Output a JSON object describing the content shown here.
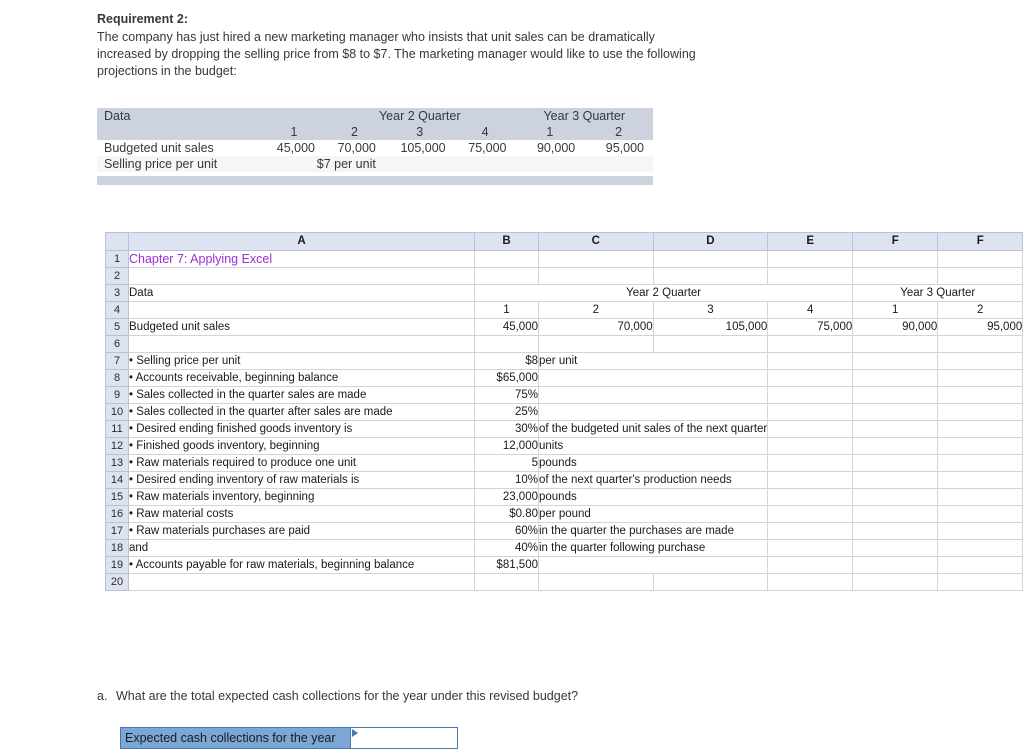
{
  "requirement": {
    "title": "Requirement 2:",
    "paragraph": "The company has just hired a new marketing manager who insists that unit sales can be dramatically increased by dropping the selling price from $8 to $7. The marketing manager would like to use the following projections in the budget:"
  },
  "data_table": {
    "header_label": "Data",
    "group_year2": "Year 2 Quarter",
    "group_year3": "Year 3 Quarter",
    "quarter_headers": [
      "1",
      "2",
      "3",
      "4",
      "1",
      "2"
    ],
    "rows": [
      {
        "label": "Budgeted unit sales",
        "values": [
          "45,000",
          "70,000",
          "105,000",
          "75,000",
          "90,000",
          "95,000"
        ]
      },
      {
        "label": "Selling price per unit",
        "merged_value": "$7 per unit"
      }
    ]
  },
  "sheet": {
    "column_headers": [
      "A",
      "B",
      "C",
      "D",
      "E",
      "F",
      "F"
    ],
    "row_numbers": [
      "1",
      "2",
      "3",
      "4",
      "5",
      "6",
      "7",
      "8",
      "9",
      "10",
      "11",
      "12",
      "13",
      "14",
      "15",
      "16",
      "17",
      "18",
      "19",
      "20"
    ],
    "title": "Chapter 7: Applying Excel",
    "title_color": "#9b2fd1",
    "data_label": "Data",
    "group_year2": "Year 2 Quarter",
    "group_year3": "Year 3 Quarter",
    "quarter_headers": [
      "1",
      "2",
      "3",
      "4",
      "1",
      "2"
    ],
    "budgeted_unit_sales_label": "Budgeted unit sales",
    "budgeted_unit_sales": [
      "45,000",
      "70,000",
      "105,000",
      "75,000",
      "90,000",
      "95,000"
    ],
    "items": [
      {
        "row": "7",
        "label": "• Selling price per unit",
        "value": "$8",
        "note": "per unit"
      },
      {
        "row": "8",
        "label": "• Accounts receivable, beginning balance",
        "value": "$65,000",
        "note": ""
      },
      {
        "row": "9",
        "label": "• Sales collected in the quarter sales are made",
        "value": "75%",
        "note": ""
      },
      {
        "row": "10",
        "label": "• Sales collected in the quarter after sales are made",
        "value": "25%",
        "note": ""
      },
      {
        "row": "11",
        "label": "• Desired ending finished goods inventory is",
        "value": "30%",
        "note": "of the budgeted unit sales of the next quarter"
      },
      {
        "row": "12",
        "label": "• Finished goods inventory, beginning",
        "value": "12,000",
        "note": "units"
      },
      {
        "row": "13",
        "label": "• Raw materials required to produce one unit",
        "value": "5",
        "note": "pounds"
      },
      {
        "row": "14",
        "label": "• Desired ending inventory of raw materials is",
        "value": "10%",
        "note": "of the next quarter's production needs"
      },
      {
        "row": "15",
        "label": "• Raw materials inventory, beginning",
        "value": "23,000",
        "note": "pounds"
      },
      {
        "row": "16",
        "label": "• Raw material costs",
        "value": "$0.80",
        "note": "per pound"
      },
      {
        "row": "17",
        "label": "• Raw materials purchases are paid",
        "value": "60%",
        "note": "in the quarter the purchases are made"
      },
      {
        "row": "18",
        "label": "and",
        "value": "40%",
        "note": "in the quarter following purchase",
        "indent": true
      },
      {
        "row": "19",
        "label": "• Accounts payable for raw materials, beginning balance",
        "value": "$81,500",
        "note": ""
      }
    ]
  },
  "question": {
    "letter": "a.",
    "text": "What are the total expected cash collections for the year under this revised budget?"
  },
  "answer": {
    "label": "Expected cash collections for the year",
    "value": "",
    "accent_color": "#7ba7d7"
  }
}
